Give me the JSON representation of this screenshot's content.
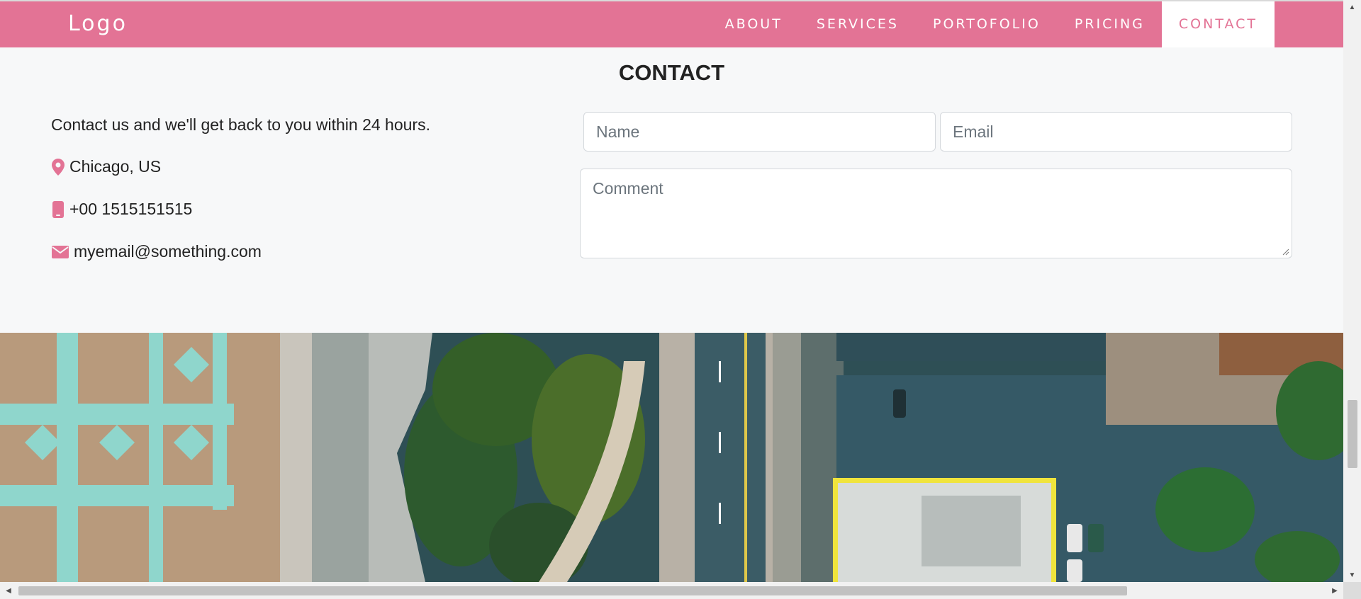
{
  "navbar": {
    "logo": "Logo",
    "items": [
      {
        "label": "ABOUT",
        "active": false
      },
      {
        "label": "SERVICES",
        "active": false
      },
      {
        "label": "PORTOFOLIO",
        "active": false
      },
      {
        "label": "PRICING",
        "active": false
      },
      {
        "label": "CONTACT",
        "active": true
      }
    ]
  },
  "contact": {
    "title": "CONTACT",
    "intro": "Contact us and we'll get back to you within 24 hours.",
    "location": {
      "icon": "map-marker-icon",
      "text": "Chicago, US"
    },
    "phone": {
      "icon": "mobile-phone-icon",
      "text": "+00 1515151515"
    },
    "email": {
      "icon": "envelope-icon",
      "text": "myemail@something.com"
    },
    "form": {
      "name_placeholder": "Name",
      "email_placeholder": "Email",
      "comment_placeholder": "Comment"
    }
  },
  "colors": {
    "accent": "#e37395",
    "background": "#f7f8f9",
    "text": "#222222"
  }
}
